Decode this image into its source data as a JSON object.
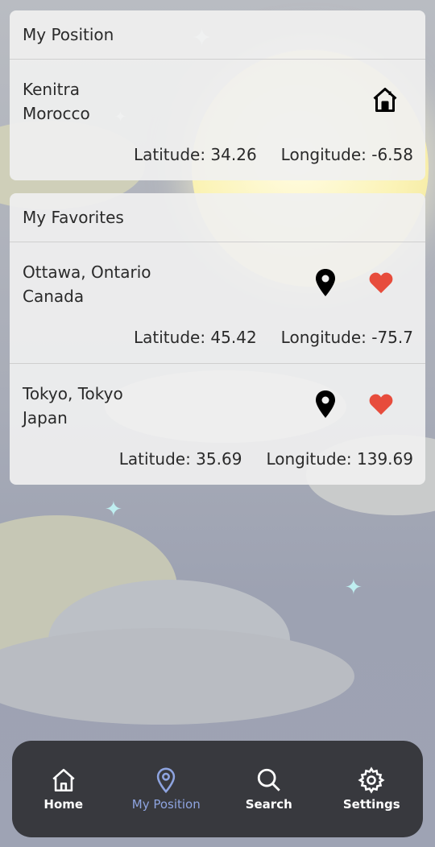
{
  "my_position": {
    "header": "My Position",
    "location": {
      "city": "Kenitra",
      "country": "Morocco",
      "latitude": "Latitude: 34.26",
      "longitude": "Longitude: -6.58",
      "icon": "home-icon"
    }
  },
  "favorites": {
    "header": "My Favorites",
    "items": [
      {
        "city": "Ottawa, Ontario",
        "country": "Canada",
        "latitude": "Latitude: 45.42",
        "longitude": "Longitude: -75.7"
      },
      {
        "city": "Tokyo, Tokyo",
        "country": "Japan",
        "latitude": "Latitude: 35.69",
        "longitude": "Longitude: 139.69"
      }
    ]
  },
  "tabs": [
    {
      "label": "Home",
      "icon": "home-icon",
      "active": false
    },
    {
      "label": "My Position",
      "icon": "map-pin-icon",
      "active": true
    },
    {
      "label": "Search",
      "icon": "search-icon",
      "active": false
    },
    {
      "label": "Settings",
      "icon": "gear-icon",
      "active": false
    }
  ],
  "colors": {
    "heart": "#e74c3c",
    "tab_active": "#8ea4e0",
    "tabbar_bg": "#38393e"
  }
}
